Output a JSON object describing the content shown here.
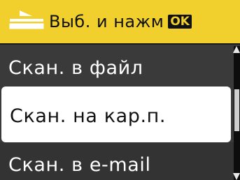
{
  "header": {
    "title": "Выб. и нажм",
    "ok_label": "OK",
    "icon": "scanner-icon",
    "background_color": "#f1cf2d"
  },
  "menu": {
    "items": [
      {
        "label": "Скан. в файл",
        "selected": false
      },
      {
        "label": "Скан. на кар.п.",
        "selected": true
      },
      {
        "label": "Скан. в e-mail",
        "selected": false
      }
    ]
  }
}
